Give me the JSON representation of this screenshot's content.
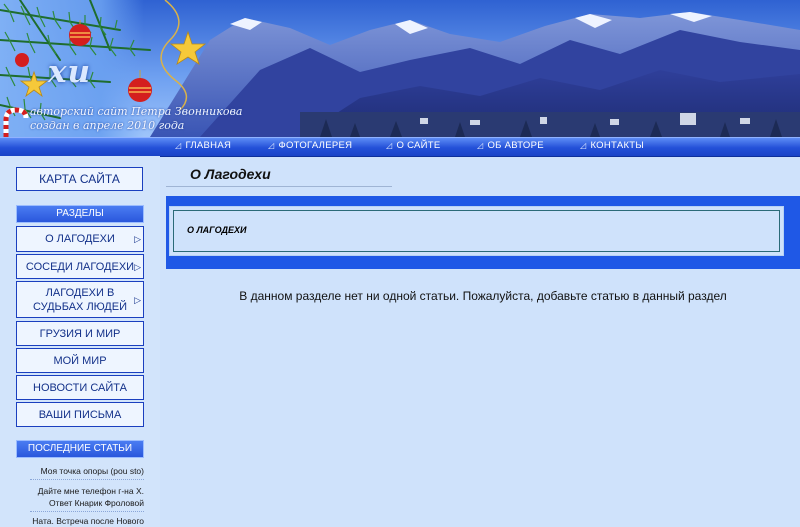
{
  "header": {
    "site_title": "хи",
    "subtitle_line1": "авторский сайт Петра Звонникова",
    "subtitle_line2": "создан в апреле 2010 года"
  },
  "nav": {
    "marker": "◿",
    "items": [
      "ГЛАВНАЯ",
      "ФОТОГАЛЕРЕЯ",
      "О САЙТЕ",
      "ОБ АВТОРЕ",
      "КОНТАКТЫ"
    ]
  },
  "sidebar": {
    "sitemap_label": "КАРТА САЙТА",
    "sections_header": "РАЗДЕЛЫ",
    "sections": [
      {
        "label": "О ЛАГОДЕХИ",
        "arrow": "▷"
      },
      {
        "label": "СОСЕДИ ЛАГОДЕХИ",
        "arrow": "▷"
      },
      {
        "label": "ЛАГОДЕХИ В СУДЬБАХ ЛЮДЕЙ",
        "arrow": "▷"
      },
      {
        "label": "ГРУЗИЯ И МИР",
        "arrow": ""
      },
      {
        "label": "МОЙ МИР",
        "arrow": ""
      },
      {
        "label": "НОВОСТИ САЙТА",
        "arrow": ""
      },
      {
        "label": "ВАШИ ПИСЬМА",
        "arrow": ""
      }
    ],
    "latest_header": "ПОСЛЕДНИЕ СТАТЬИ",
    "latest_articles": [
      "Моя точка опоры (pou sto)",
      "Дайте мне телефон г-на Х. Ответ Кнарик Фроловой",
      "Ната. Встреча после Нового"
    ]
  },
  "content": {
    "title": "О Лагодехи",
    "section_label": "О ЛАГОДЕХИ",
    "empty_message": "В данном разделе нет ни одной статьи. Пожалуйста, добавьте статью в данный раздел"
  },
  "colors": {
    "accent_blue": "#1f58e6",
    "page_background": "#cfe2fb",
    "sidebar_border": "#1a3fbf"
  }
}
